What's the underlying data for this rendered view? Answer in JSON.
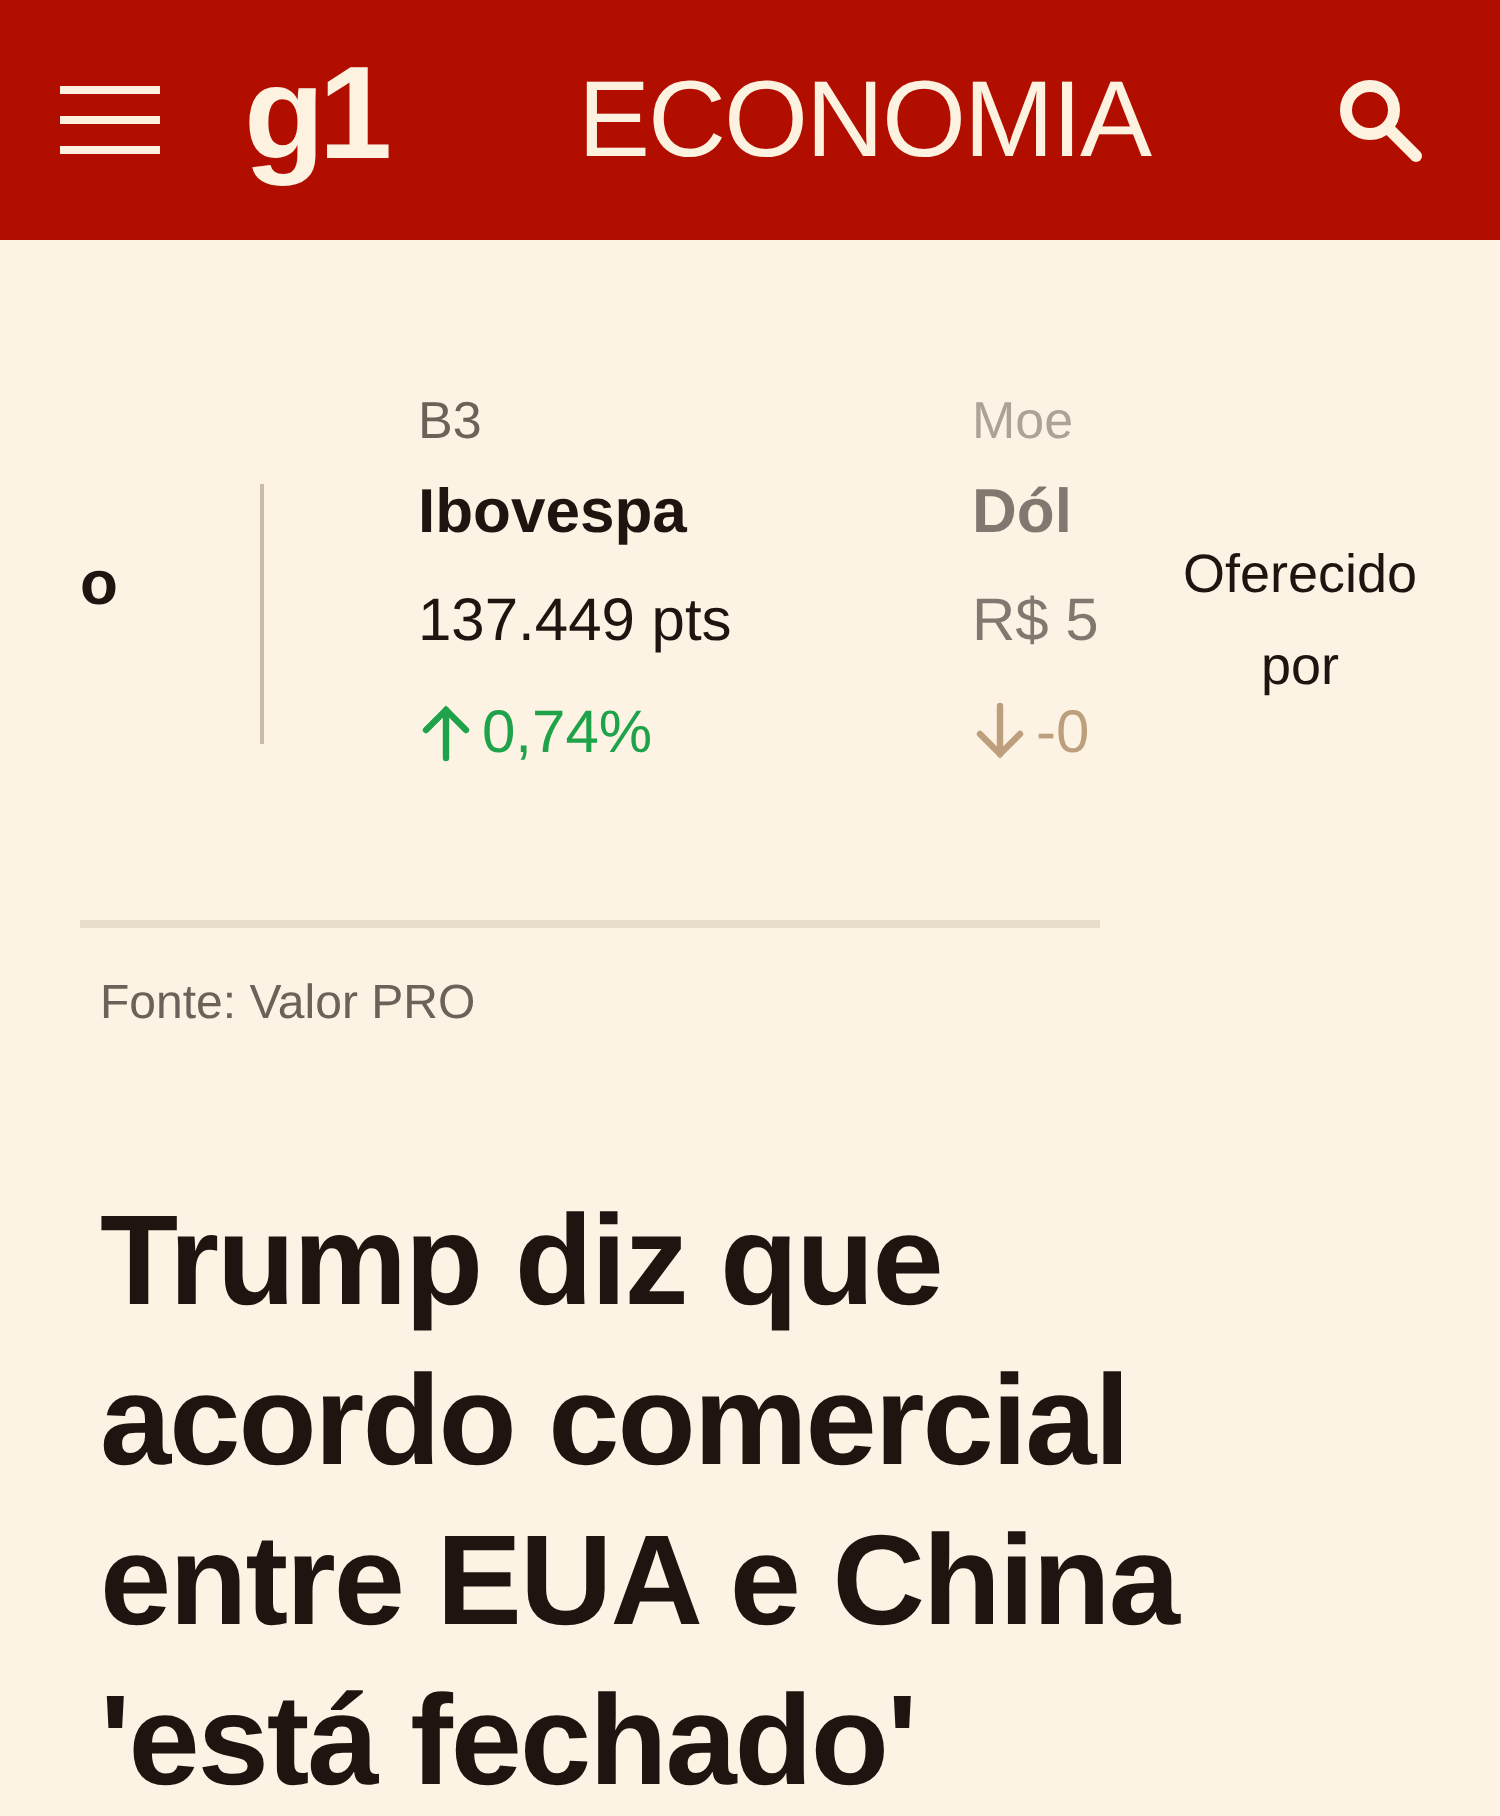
{
  "header": {
    "logo": "g1",
    "section": "ECONOMIA"
  },
  "ticker": {
    "cards": [
      {
        "name": "o",
        "faded": false
      },
      {
        "label": "B3",
        "name": "Ibovespa",
        "value": "137.449 pts",
        "change": "0,74%",
        "kind": "up",
        "faded": false
      },
      {
        "label": "Moe",
        "name": "Dól",
        "value": "R$ 5",
        "change": "-0",
        "kind": "down",
        "faded": true
      }
    ],
    "sponsor": "Oferecido por",
    "source": "Fonte: Valor PRO"
  },
  "headline": "Trump diz que acordo comercial entre EUA e China 'está fechado'"
}
